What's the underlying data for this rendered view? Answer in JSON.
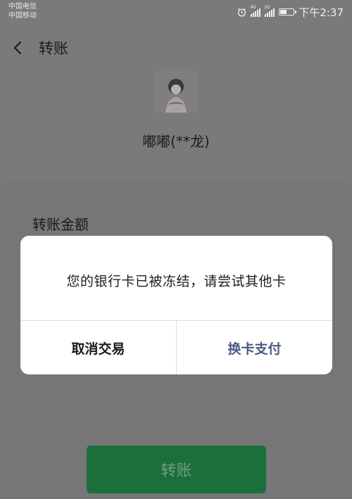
{
  "status_bar": {
    "carrier_1": "中国电信",
    "carrier_2": "中国移动",
    "network_1": "4G",
    "network_2": "2G",
    "time": "下午2:37",
    "icons": [
      "alarm-icon",
      "signal-icon",
      "battery-icon"
    ]
  },
  "nav": {
    "title": "转账",
    "back_icon": "chevron-left-icon"
  },
  "payee": {
    "name": "嘟嘟(**龙)"
  },
  "form": {
    "amount_label": "转账金额"
  },
  "dialog": {
    "message": "您的银行卡已被冻结，请尝试其他卡",
    "cancel_label": "取消交易",
    "switch_label": "换卡支付"
  },
  "action": {
    "transfer_label": "转账"
  },
  "colors": {
    "overlay": "#7a7a7a",
    "dialog_bg": "#ffffff",
    "switch_text": "#4a5a82",
    "primary_button": "#1a6f3a"
  }
}
